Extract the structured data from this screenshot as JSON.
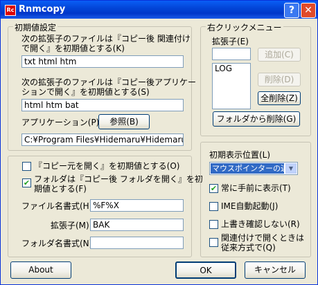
{
  "window": {
    "title": "Rnmcopy",
    "icon_label": "Rc",
    "help_label": "?",
    "close_label": "✕"
  },
  "initial_settings": {
    "group_title": "初期値設定",
    "ext_open_line1": "次の拡張子のファイルは『コピー後 関連付け",
    "ext_open_line2": "で開く』を初期値とする(K)",
    "ext_open_value": "txt html htm",
    "ext_app_line1": "次の拡張子のファイルは『コピー後アプリケー",
    "ext_app_line2": "ションで開く』を初期値とする(S)",
    "ext_app_value": "html htm bat",
    "app_label": "アプリケーション(P)",
    "browse_label": "参照(B)",
    "app_path": "C:¥Program Files¥Hidemaru¥Hidemaru.exe"
  },
  "options": {
    "open_source_label": "『コピー元を開く』を初期値とする(O)",
    "open_source_checked": false,
    "open_folder_line1": "フォルダは『コピー後 フォルダを開く』を初",
    "open_folder_line2": "期値とする(F)",
    "open_folder_checked": true
  },
  "formats": {
    "filename_label": "ファイル名書式(H)",
    "filename_value": "%F%X",
    "ext_label": "拡張子(M)",
    "ext_value": "BAK",
    "folder_label": "フォルダ名書式(N)",
    "folder_value": ""
  },
  "context_menu": {
    "group_title": "右クリックメニュー",
    "ext_label": "拡張子(E)",
    "ext_input": "",
    "items": [
      "LOG"
    ],
    "add_label": "追加(C)",
    "delete_label": "削除(D)",
    "delete_all_label": "全削除(Z)",
    "remove_folder_label": "フォルダから削除(G)"
  },
  "display": {
    "group_title": "初期表示位置(L)",
    "position_value": "マウスポインターの近く",
    "always_on_top_label": "常に手前に表示(T)",
    "always_on_top_checked": true,
    "ime_label": "IME自動起動(J)",
    "ime_checked": false,
    "no_overwrite_label": "上書き確認しない(R)",
    "no_overwrite_checked": false,
    "legacy_line1": "関連付けで開くときは",
    "legacy_line2": "従来方式で(Q)",
    "legacy_checked": false
  },
  "footer": {
    "about_label": "About",
    "ok_label": "OK",
    "cancel_label": "キャンセル"
  }
}
